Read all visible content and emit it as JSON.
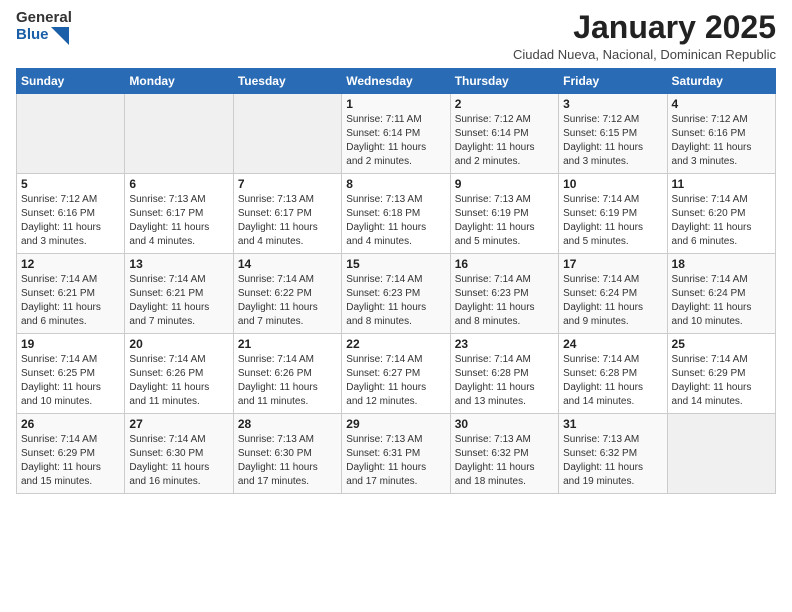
{
  "logo": {
    "general": "General",
    "blue": "Blue"
  },
  "header": {
    "title": "January 2025",
    "subtitle": "Ciudad Nueva, Nacional, Dominican Republic"
  },
  "weekdays": [
    "Sunday",
    "Monday",
    "Tuesday",
    "Wednesday",
    "Thursday",
    "Friday",
    "Saturday"
  ],
  "weeks": [
    [
      {
        "day": "",
        "info": ""
      },
      {
        "day": "",
        "info": ""
      },
      {
        "day": "",
        "info": ""
      },
      {
        "day": "1",
        "info": "Sunrise: 7:11 AM\nSunset: 6:14 PM\nDaylight: 11 hours\nand 2 minutes."
      },
      {
        "day": "2",
        "info": "Sunrise: 7:12 AM\nSunset: 6:14 PM\nDaylight: 11 hours\nand 2 minutes."
      },
      {
        "day": "3",
        "info": "Sunrise: 7:12 AM\nSunset: 6:15 PM\nDaylight: 11 hours\nand 3 minutes."
      },
      {
        "day": "4",
        "info": "Sunrise: 7:12 AM\nSunset: 6:16 PM\nDaylight: 11 hours\nand 3 minutes."
      }
    ],
    [
      {
        "day": "5",
        "info": "Sunrise: 7:12 AM\nSunset: 6:16 PM\nDaylight: 11 hours\nand 3 minutes."
      },
      {
        "day": "6",
        "info": "Sunrise: 7:13 AM\nSunset: 6:17 PM\nDaylight: 11 hours\nand 4 minutes."
      },
      {
        "day": "7",
        "info": "Sunrise: 7:13 AM\nSunset: 6:17 PM\nDaylight: 11 hours\nand 4 minutes."
      },
      {
        "day": "8",
        "info": "Sunrise: 7:13 AM\nSunset: 6:18 PM\nDaylight: 11 hours\nand 4 minutes."
      },
      {
        "day": "9",
        "info": "Sunrise: 7:13 AM\nSunset: 6:19 PM\nDaylight: 11 hours\nand 5 minutes."
      },
      {
        "day": "10",
        "info": "Sunrise: 7:14 AM\nSunset: 6:19 PM\nDaylight: 11 hours\nand 5 minutes."
      },
      {
        "day": "11",
        "info": "Sunrise: 7:14 AM\nSunset: 6:20 PM\nDaylight: 11 hours\nand 6 minutes."
      }
    ],
    [
      {
        "day": "12",
        "info": "Sunrise: 7:14 AM\nSunset: 6:21 PM\nDaylight: 11 hours\nand 6 minutes."
      },
      {
        "day": "13",
        "info": "Sunrise: 7:14 AM\nSunset: 6:21 PM\nDaylight: 11 hours\nand 7 minutes."
      },
      {
        "day": "14",
        "info": "Sunrise: 7:14 AM\nSunset: 6:22 PM\nDaylight: 11 hours\nand 7 minutes."
      },
      {
        "day": "15",
        "info": "Sunrise: 7:14 AM\nSunset: 6:23 PM\nDaylight: 11 hours\nand 8 minutes."
      },
      {
        "day": "16",
        "info": "Sunrise: 7:14 AM\nSunset: 6:23 PM\nDaylight: 11 hours\nand 8 minutes."
      },
      {
        "day": "17",
        "info": "Sunrise: 7:14 AM\nSunset: 6:24 PM\nDaylight: 11 hours\nand 9 minutes."
      },
      {
        "day": "18",
        "info": "Sunrise: 7:14 AM\nSunset: 6:24 PM\nDaylight: 11 hours\nand 10 minutes."
      }
    ],
    [
      {
        "day": "19",
        "info": "Sunrise: 7:14 AM\nSunset: 6:25 PM\nDaylight: 11 hours\nand 10 minutes."
      },
      {
        "day": "20",
        "info": "Sunrise: 7:14 AM\nSunset: 6:26 PM\nDaylight: 11 hours\nand 11 minutes."
      },
      {
        "day": "21",
        "info": "Sunrise: 7:14 AM\nSunset: 6:26 PM\nDaylight: 11 hours\nand 11 minutes."
      },
      {
        "day": "22",
        "info": "Sunrise: 7:14 AM\nSunset: 6:27 PM\nDaylight: 11 hours\nand 12 minutes."
      },
      {
        "day": "23",
        "info": "Sunrise: 7:14 AM\nSunset: 6:28 PM\nDaylight: 11 hours\nand 13 minutes."
      },
      {
        "day": "24",
        "info": "Sunrise: 7:14 AM\nSunset: 6:28 PM\nDaylight: 11 hours\nand 14 minutes."
      },
      {
        "day": "25",
        "info": "Sunrise: 7:14 AM\nSunset: 6:29 PM\nDaylight: 11 hours\nand 14 minutes."
      }
    ],
    [
      {
        "day": "26",
        "info": "Sunrise: 7:14 AM\nSunset: 6:29 PM\nDaylight: 11 hours\nand 15 minutes."
      },
      {
        "day": "27",
        "info": "Sunrise: 7:14 AM\nSunset: 6:30 PM\nDaylight: 11 hours\nand 16 minutes."
      },
      {
        "day": "28",
        "info": "Sunrise: 7:13 AM\nSunset: 6:30 PM\nDaylight: 11 hours\nand 17 minutes."
      },
      {
        "day": "29",
        "info": "Sunrise: 7:13 AM\nSunset: 6:31 PM\nDaylight: 11 hours\nand 17 minutes."
      },
      {
        "day": "30",
        "info": "Sunrise: 7:13 AM\nSunset: 6:32 PM\nDaylight: 11 hours\nand 18 minutes."
      },
      {
        "day": "31",
        "info": "Sunrise: 7:13 AM\nSunset: 6:32 PM\nDaylight: 11 hours\nand 19 minutes."
      },
      {
        "day": "",
        "info": ""
      }
    ]
  ]
}
